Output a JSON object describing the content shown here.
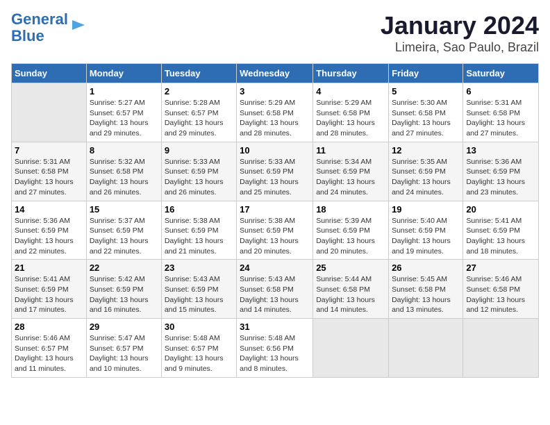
{
  "logo": {
    "part1": "General",
    "part2": "Blue"
  },
  "title": "January 2024",
  "subtitle": "Limeira, Sao Paulo, Brazil",
  "days_of_week": [
    "Sunday",
    "Monday",
    "Tuesday",
    "Wednesday",
    "Thursday",
    "Friday",
    "Saturday"
  ],
  "weeks": [
    [
      {
        "day": "",
        "info": ""
      },
      {
        "day": "1",
        "info": "Sunrise: 5:27 AM\nSunset: 6:57 PM\nDaylight: 13 hours\nand 29 minutes."
      },
      {
        "day": "2",
        "info": "Sunrise: 5:28 AM\nSunset: 6:57 PM\nDaylight: 13 hours\nand 29 minutes."
      },
      {
        "day": "3",
        "info": "Sunrise: 5:29 AM\nSunset: 6:58 PM\nDaylight: 13 hours\nand 28 minutes."
      },
      {
        "day": "4",
        "info": "Sunrise: 5:29 AM\nSunset: 6:58 PM\nDaylight: 13 hours\nand 28 minutes."
      },
      {
        "day": "5",
        "info": "Sunrise: 5:30 AM\nSunset: 6:58 PM\nDaylight: 13 hours\nand 27 minutes."
      },
      {
        "day": "6",
        "info": "Sunrise: 5:31 AM\nSunset: 6:58 PM\nDaylight: 13 hours\nand 27 minutes."
      }
    ],
    [
      {
        "day": "7",
        "info": "Sunrise: 5:31 AM\nSunset: 6:58 PM\nDaylight: 13 hours\nand 27 minutes."
      },
      {
        "day": "8",
        "info": "Sunrise: 5:32 AM\nSunset: 6:58 PM\nDaylight: 13 hours\nand 26 minutes."
      },
      {
        "day": "9",
        "info": "Sunrise: 5:33 AM\nSunset: 6:59 PM\nDaylight: 13 hours\nand 26 minutes."
      },
      {
        "day": "10",
        "info": "Sunrise: 5:33 AM\nSunset: 6:59 PM\nDaylight: 13 hours\nand 25 minutes."
      },
      {
        "day": "11",
        "info": "Sunrise: 5:34 AM\nSunset: 6:59 PM\nDaylight: 13 hours\nand 24 minutes."
      },
      {
        "day": "12",
        "info": "Sunrise: 5:35 AM\nSunset: 6:59 PM\nDaylight: 13 hours\nand 24 minutes."
      },
      {
        "day": "13",
        "info": "Sunrise: 5:36 AM\nSunset: 6:59 PM\nDaylight: 13 hours\nand 23 minutes."
      }
    ],
    [
      {
        "day": "14",
        "info": "Sunrise: 5:36 AM\nSunset: 6:59 PM\nDaylight: 13 hours\nand 22 minutes."
      },
      {
        "day": "15",
        "info": "Sunrise: 5:37 AM\nSunset: 6:59 PM\nDaylight: 13 hours\nand 22 minutes."
      },
      {
        "day": "16",
        "info": "Sunrise: 5:38 AM\nSunset: 6:59 PM\nDaylight: 13 hours\nand 21 minutes."
      },
      {
        "day": "17",
        "info": "Sunrise: 5:38 AM\nSunset: 6:59 PM\nDaylight: 13 hours\nand 20 minutes."
      },
      {
        "day": "18",
        "info": "Sunrise: 5:39 AM\nSunset: 6:59 PM\nDaylight: 13 hours\nand 20 minutes."
      },
      {
        "day": "19",
        "info": "Sunrise: 5:40 AM\nSunset: 6:59 PM\nDaylight: 13 hours\nand 19 minutes."
      },
      {
        "day": "20",
        "info": "Sunrise: 5:41 AM\nSunset: 6:59 PM\nDaylight: 13 hours\nand 18 minutes."
      }
    ],
    [
      {
        "day": "21",
        "info": "Sunrise: 5:41 AM\nSunset: 6:59 PM\nDaylight: 13 hours\nand 17 minutes."
      },
      {
        "day": "22",
        "info": "Sunrise: 5:42 AM\nSunset: 6:59 PM\nDaylight: 13 hours\nand 16 minutes."
      },
      {
        "day": "23",
        "info": "Sunrise: 5:43 AM\nSunset: 6:59 PM\nDaylight: 13 hours\nand 15 minutes."
      },
      {
        "day": "24",
        "info": "Sunrise: 5:43 AM\nSunset: 6:58 PM\nDaylight: 13 hours\nand 14 minutes."
      },
      {
        "day": "25",
        "info": "Sunrise: 5:44 AM\nSunset: 6:58 PM\nDaylight: 13 hours\nand 14 minutes."
      },
      {
        "day": "26",
        "info": "Sunrise: 5:45 AM\nSunset: 6:58 PM\nDaylight: 13 hours\nand 13 minutes."
      },
      {
        "day": "27",
        "info": "Sunrise: 5:46 AM\nSunset: 6:58 PM\nDaylight: 13 hours\nand 12 minutes."
      }
    ],
    [
      {
        "day": "28",
        "info": "Sunrise: 5:46 AM\nSunset: 6:57 PM\nDaylight: 13 hours\nand 11 minutes."
      },
      {
        "day": "29",
        "info": "Sunrise: 5:47 AM\nSunset: 6:57 PM\nDaylight: 13 hours\nand 10 minutes."
      },
      {
        "day": "30",
        "info": "Sunrise: 5:48 AM\nSunset: 6:57 PM\nDaylight: 13 hours\nand 9 minutes."
      },
      {
        "day": "31",
        "info": "Sunrise: 5:48 AM\nSunset: 6:56 PM\nDaylight: 13 hours\nand 8 minutes."
      },
      {
        "day": "",
        "info": ""
      },
      {
        "day": "",
        "info": ""
      },
      {
        "day": "",
        "info": ""
      }
    ]
  ]
}
